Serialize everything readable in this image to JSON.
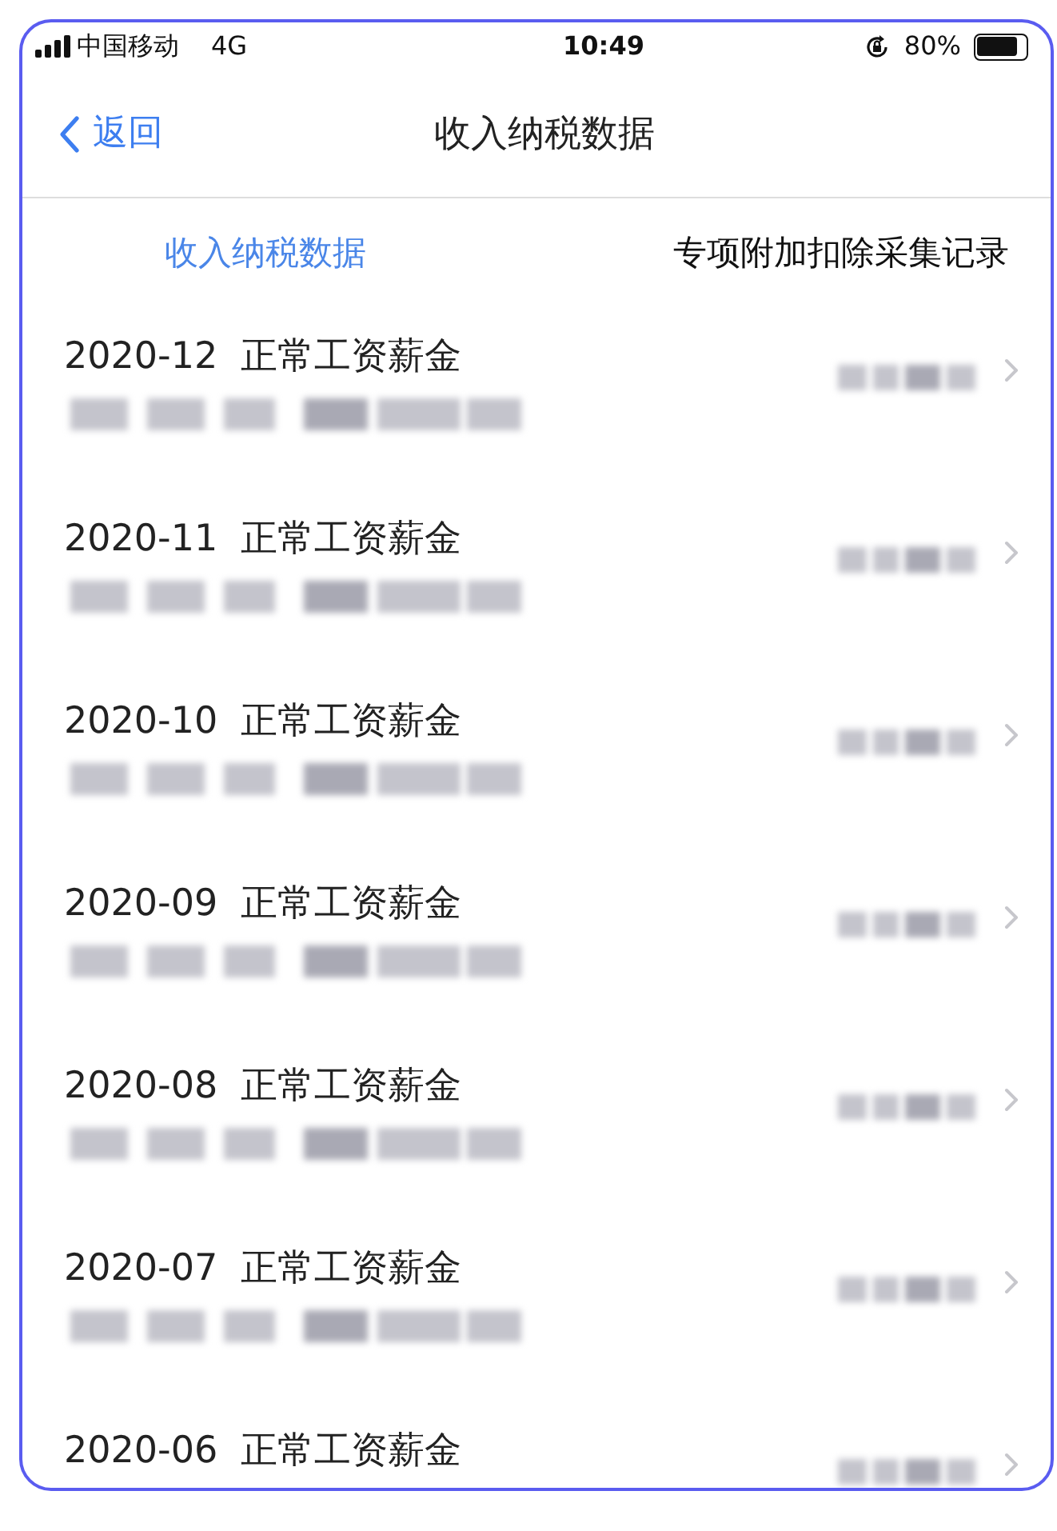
{
  "status_bar": {
    "carrier": "中国移动",
    "network": "4G",
    "time": "10:49",
    "battery": "80%"
  },
  "nav": {
    "back": "返回",
    "title": "收入纳税数据"
  },
  "tabs": [
    {
      "label": "收入纳税数据",
      "selected": true
    },
    {
      "label": "专项附加扣除采集记录",
      "selected": false
    }
  ],
  "records": [
    {
      "title": "2020-12  正常工资薪金"
    },
    {
      "title": "2020-11  正常工资薪金"
    },
    {
      "title": "2020-10  正常工资薪金"
    },
    {
      "title": "2020-09  正常工资薪金"
    },
    {
      "title": "2020-08  正常工资薪金"
    },
    {
      "title": "2020-07  正常工资薪金"
    },
    {
      "title": "2020-06  正常工资薪金"
    }
  ]
}
